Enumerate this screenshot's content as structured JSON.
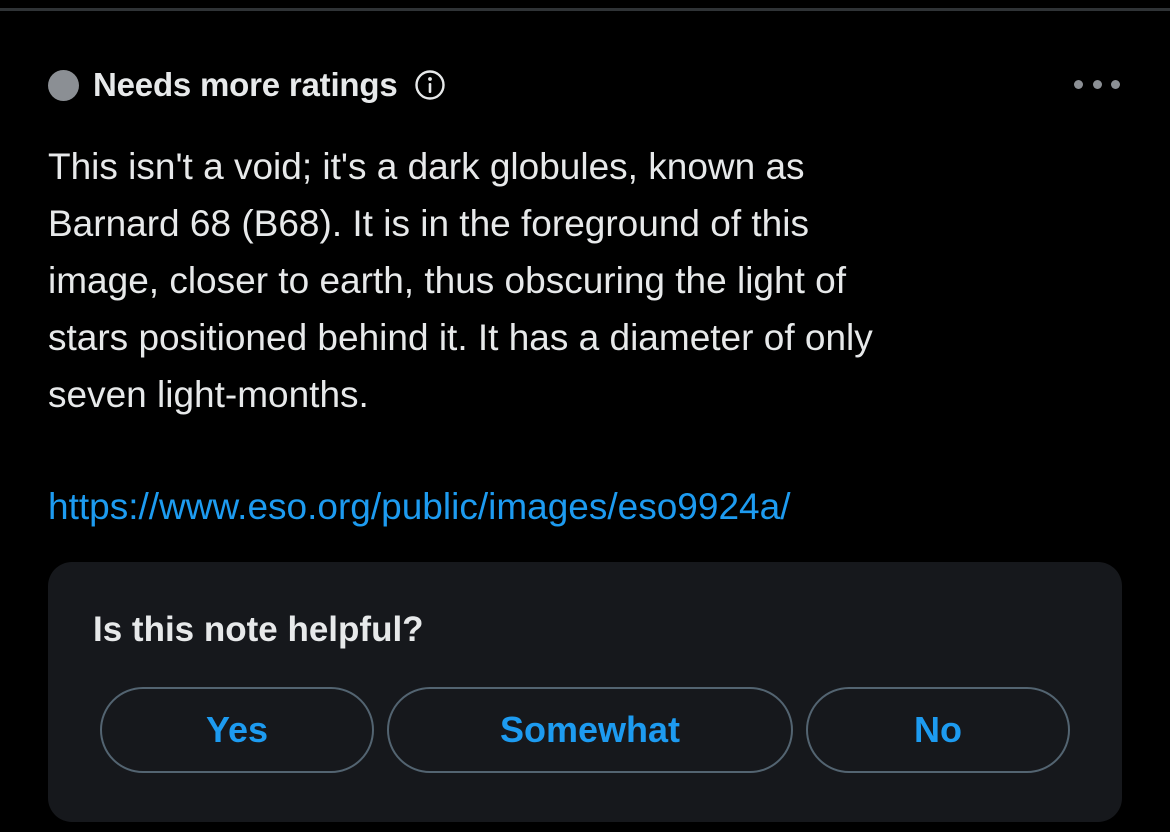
{
  "note": {
    "status_label": "Needs more ratings",
    "status_color": "#8b8f94",
    "info_icon": "info-circle-icon",
    "more_icon": "more-horizontal-icon",
    "text": "This isn't a void; it's a dark globules, known as\nBarnard 68 (B68). It is in the foreground of this\nimage, closer to earth, thus obscuring the light of\nstars positioned behind it.  It has a diameter of only\nseven light-months.",
    "link": "https://www.eso.org/public/images/eso9924a/"
  },
  "helpful": {
    "question": "Is this note helpful?",
    "options": {
      "yes": "Yes",
      "somewhat": "Somewhat",
      "no": "No"
    }
  },
  "colors": {
    "background": "#000000",
    "card": "#16181c",
    "accent": "#1d9bf0",
    "text": "#e7e9ea",
    "muted": "#8b8f94",
    "border": "#536471"
  }
}
